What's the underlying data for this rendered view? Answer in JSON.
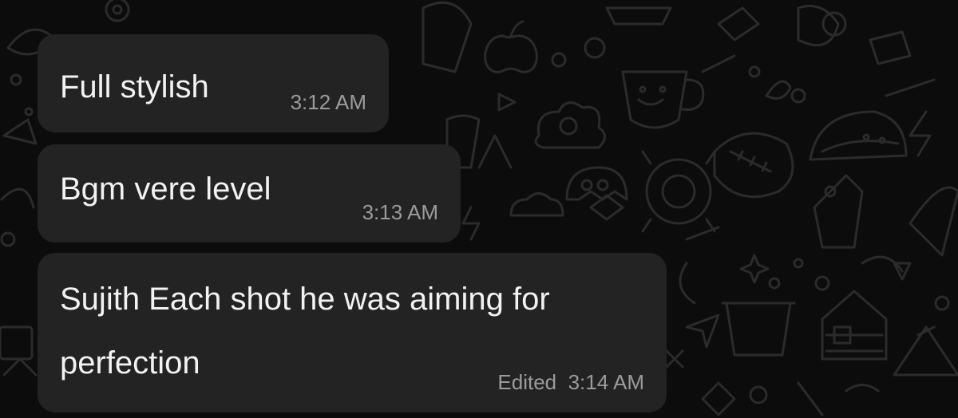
{
  "messages": [
    {
      "text": "Full stylish",
      "time": "3:12 AM",
      "edited_label": ""
    },
    {
      "text": "Bgm vere level",
      "time": "3:13 AM",
      "edited_label": ""
    },
    {
      "lines": [
        "Sujith Each shot he was aiming for",
        "perfection"
      ],
      "time": "3:14 AM",
      "edited_label": "Edited"
    }
  ],
  "colors": {
    "background": "#0c0c0c",
    "bubble": "#232323",
    "text": "#f2f2f2",
    "meta": "#9b9b9b",
    "doodle": "#2b2b2b"
  },
  "background_icons": [
    "apple-icon",
    "cup-icon",
    "football-icon",
    "taco-icon",
    "flower-pot-icon",
    "house-icon",
    "leaf-icon",
    "paper-plane-icon",
    "cloud-icon",
    "sparkle-icon"
  ]
}
